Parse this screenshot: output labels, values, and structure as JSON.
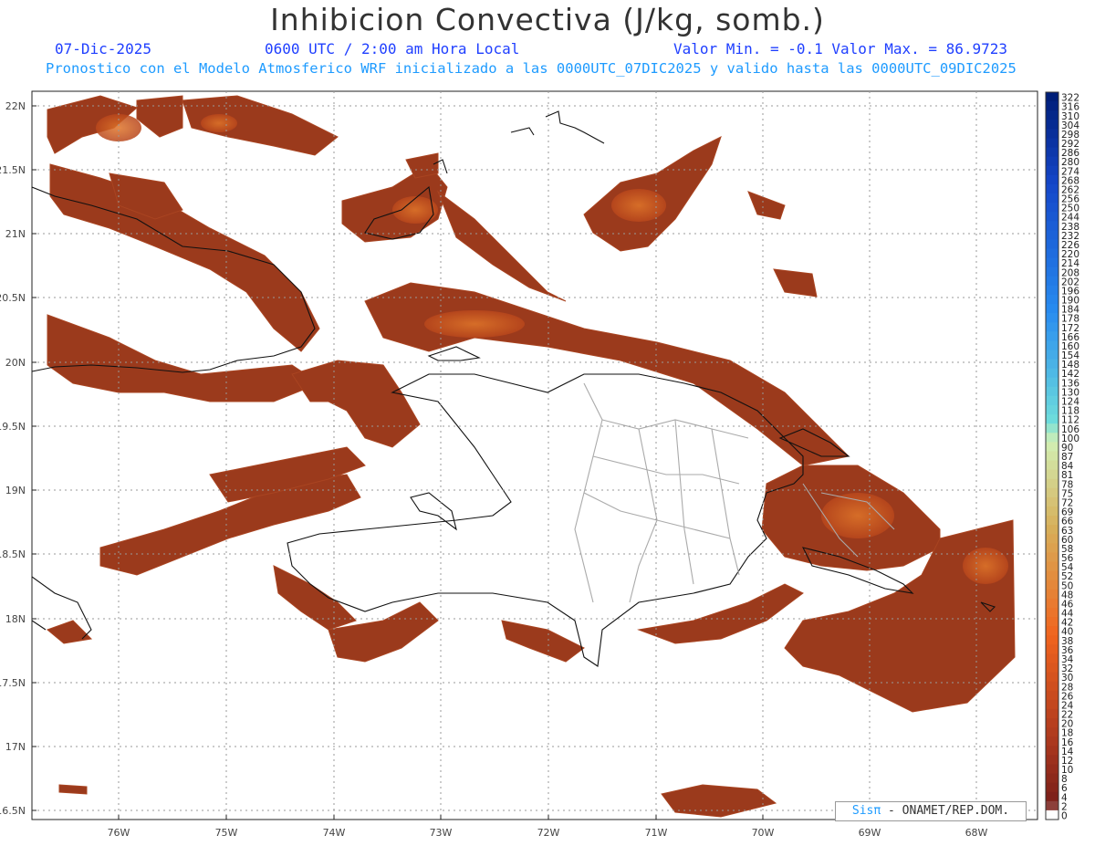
{
  "header": {
    "title": "Inhibicion Convectiva (J/kg, somb.)",
    "date": "07-Dic-2025",
    "time": "0600 UTC / 2:00 am Hora Local",
    "minmax": "Valor Min. = -0.1  Valor Max. = 86.9723",
    "forecast": "Pronostico con el Modelo Atmosferico WRF inicializado a las 0000UTC_07DIC2025 y valido hasta las  0000UTC_09DIC2025"
  },
  "axes": {
    "lat_labels": [
      "22N",
      "21.5N",
      "21N",
      "20.5N",
      "20N",
      "19.5N",
      "19N",
      "18.5N",
      "18N",
      "17.5N",
      "17N",
      "16.5N"
    ],
    "lon_labels": [
      "76W",
      "75W",
      "74W",
      "73W",
      "72W",
      "71W",
      "70W",
      "69W",
      "68W"
    ]
  },
  "colorbar": {
    "labels": [
      "322",
      "316",
      "310",
      "304",
      "298",
      "292",
      "286",
      "280",
      "274",
      "268",
      "262",
      "256",
      "250",
      "244",
      "238",
      "232",
      "226",
      "220",
      "214",
      "208",
      "202",
      "196",
      "190",
      "184",
      "178",
      "172",
      "166",
      "160",
      "154",
      "148",
      "142",
      "136",
      "130",
      "124",
      "118",
      "112",
      "106",
      "100",
      "90",
      "87",
      "84",
      "81",
      "78",
      "75",
      "72",
      "69",
      "66",
      "63",
      "60",
      "58",
      "56",
      "54",
      "52",
      "50",
      "48",
      "46",
      "44",
      "42",
      "40",
      "38",
      "36",
      "34",
      "32",
      "30",
      "28",
      "26",
      "24",
      "22",
      "20",
      "18",
      "16",
      "14",
      "12",
      "10",
      "8",
      "6",
      "4",
      "2",
      "0"
    ]
  },
  "credit": {
    "brand": "Sisπ",
    "text": " - ONAMET/REP.DOM."
  },
  "colors": {
    "fill_dark": "#8b2e16",
    "fill_mid": "#a9401e",
    "fill_bright": "#d4601f",
    "border_country": "#111111",
    "border_province": "#aaaaaa",
    "grid": "#999999"
  }
}
